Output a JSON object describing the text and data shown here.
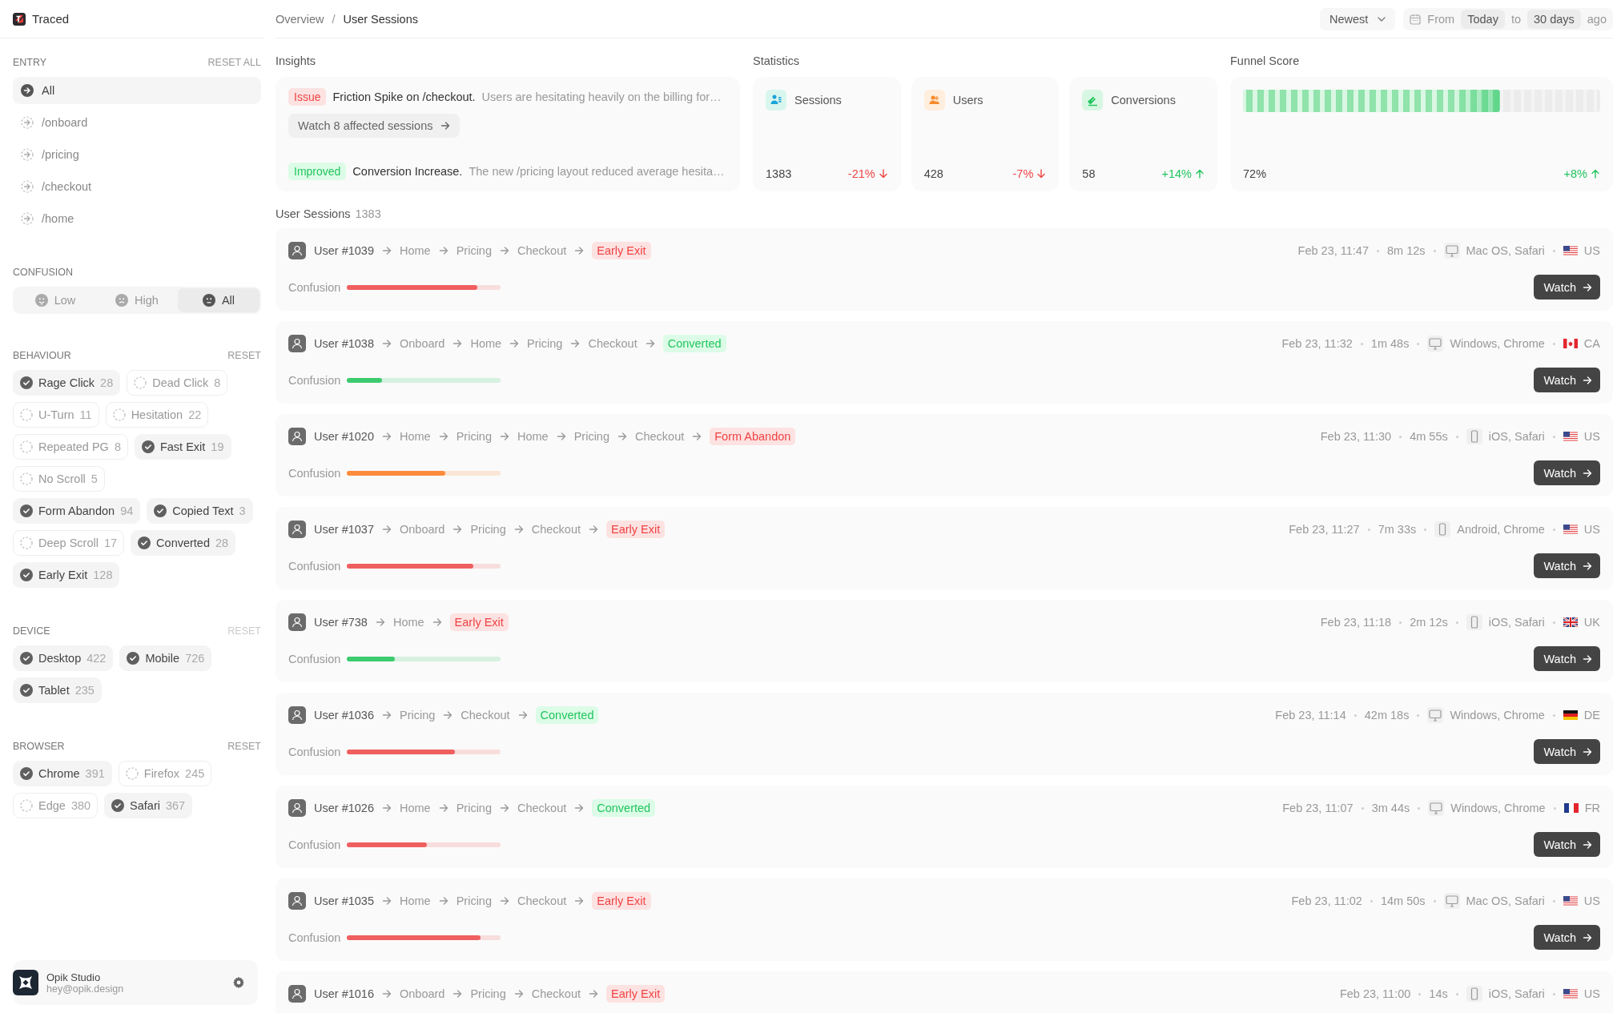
{
  "brand": {
    "name": "Traced"
  },
  "breadcrumb": {
    "separator": "/",
    "items": [
      "Overview",
      "User Sessions"
    ]
  },
  "sort": {
    "label": "Newest"
  },
  "date_range": {
    "from_label": "From",
    "from": "Today",
    "to_label": "to",
    "to": "30 days",
    "suffix": "ago"
  },
  "sidebar": {
    "entry": {
      "title": "ENTRY",
      "reset": "RESET ALL",
      "items": [
        {
          "label": "All",
          "selected": true
        },
        {
          "label": "/onboard",
          "selected": false
        },
        {
          "label": "/pricing",
          "selected": false
        },
        {
          "label": "/checkout",
          "selected": false
        },
        {
          "label": "/home",
          "selected": false
        }
      ]
    },
    "confusion": {
      "title": "CONFUSION",
      "options": [
        {
          "kind": "low",
          "label": "Low",
          "selected": false
        },
        {
          "kind": "high",
          "label": "High",
          "selected": false
        },
        {
          "kind": "all",
          "label": "All",
          "selected": true
        }
      ]
    },
    "filters": [
      {
        "title": "BEHAVIOUR",
        "reset": "RESET",
        "disabled": false,
        "chip_groups": [
          [
            {
              "label": "Rage Click",
              "count": "28",
              "checked": true
            },
            {
              "label": "Dead Click",
              "count": "8",
              "checked": false
            },
            {
              "label": "U-Turn",
              "count": "11",
              "checked": false
            },
            {
              "label": "Hesitation",
              "count": "22",
              "checked": false
            }
          ],
          [
            {
              "label": "Repeated PG",
              "count": "8",
              "checked": false
            },
            {
              "label": "Fast Exit",
              "count": "19",
              "checked": true
            },
            {
              "label": "No Scroll",
              "count": "5",
              "checked": false
            }
          ],
          [
            {
              "label": "Form Abandon",
              "count": "94",
              "checked": true
            },
            {
              "label": "Copied Text",
              "count": "3",
              "checked": true
            },
            {
              "label": "Deep Scroll",
              "count": "17",
              "checked": false
            },
            {
              "label": "Converted",
              "count": "28",
              "checked": true
            },
            {
              "label": "Early Exit",
              "count": "128",
              "checked": true
            }
          ]
        ]
      },
      {
        "title": "DEVICE",
        "reset": "RESET",
        "disabled": true,
        "chip_groups": [
          [
            {
              "label": "Desktop",
              "count": "422",
              "checked": true
            },
            {
              "label": "Mobile",
              "count": "726",
              "checked": true
            },
            {
              "label": "Tablet",
              "count": "235",
              "checked": true
            }
          ]
        ]
      },
      {
        "title": "BROWSER",
        "reset": "RESET",
        "disabled": false,
        "chip_groups": [
          [
            {
              "label": "Chrome",
              "count": "391",
              "checked": true
            },
            {
              "label": "Firefox",
              "count": "245",
              "checked": false
            },
            {
              "label": "Edge",
              "count": "380",
              "checked": false
            },
            {
              "label": "Safari",
              "count": "367",
              "checked": true
            }
          ]
        ]
      }
    ],
    "account": {
      "name": "Opik Studio",
      "email": "hey@opik.design"
    }
  },
  "insights": {
    "title": "Insights",
    "items": [
      {
        "kind": "issue",
        "badge": "Issue",
        "headline": "Friction Spike on /checkout.",
        "detail": "Users are hesitating heavily on the billing for…",
        "action": "Watch 8 affected sessions"
      },
      {
        "kind": "improved",
        "badge": "Improved",
        "headline": "Conversion Increase.",
        "detail": "The new /pricing layout reduced average hesita…"
      }
    ]
  },
  "statistics": {
    "title": "Statistics",
    "cards": [
      {
        "kind": "sessions",
        "label": "Sessions",
        "value": "1383",
        "change": {
          "label": "-21%",
          "kind": "down"
        }
      },
      {
        "kind": "users",
        "label": "Users",
        "value": "428",
        "change": {
          "label": "-7%",
          "kind": "down"
        }
      },
      {
        "kind": "conversions",
        "label": "Conversions",
        "value": "58",
        "change": {
          "label": "+14%",
          "kind": "up"
        }
      }
    ]
  },
  "funnel": {
    "title": "Funnel Score",
    "level": 0.72,
    "value": "72%",
    "change": {
      "label": "+8%",
      "kind": "up"
    }
  },
  "sessions": {
    "title": "User Sessions",
    "count": "1383",
    "rows": [
      {
        "user": "User #1039",
        "path": [
          "Home",
          "Pricing",
          "Checkout"
        ],
        "outcome": {
          "label": "Early Exit",
          "kind": "negative"
        },
        "time": "Feb 23, 11:47",
        "duration": "8m 12s",
        "platform": {
          "kind": "desktop",
          "label": "Mac OS, Safari"
        },
        "country": {
          "kind": "us",
          "label": "US"
        },
        "confusion_label": "Confusion",
        "confusion": {
          "level": 0.85,
          "color": "#ef5f5f"
        },
        "action": "Watch"
      },
      {
        "user": "User #1038",
        "path": [
          "Onboard",
          "Home",
          "Pricing",
          "Checkout"
        ],
        "outcome": {
          "label": "Converted",
          "kind": "positive"
        },
        "time": "Feb 23, 11:32",
        "duration": "1m 48s",
        "platform": {
          "kind": "desktop",
          "label": "Windows, Chrome"
        },
        "country": {
          "kind": "ca",
          "label": "CA"
        },
        "confusion_label": "Confusion",
        "confusion": {
          "level": 0.23,
          "color": "#3ccb6e"
        },
        "action": "Watch"
      },
      {
        "user": "User #1020",
        "path": [
          "Home",
          "Pricing",
          "Home",
          "Pricing",
          "Checkout"
        ],
        "outcome": {
          "label": "Form Abandon",
          "kind": "negative"
        },
        "time": "Feb 23, 11:30",
        "duration": "4m 55s",
        "platform": {
          "kind": "mobile",
          "label": "iOS, Safari"
        },
        "country": {
          "kind": "us",
          "label": "US"
        },
        "confusion_label": "Confusion",
        "confusion": {
          "level": 0.64,
          "color": "#fb8c3c"
        },
        "action": "Watch"
      },
      {
        "user": "User #1037",
        "path": [
          "Onboard",
          "Pricing",
          "Checkout"
        ],
        "outcome": {
          "label": "Early Exit",
          "kind": "negative"
        },
        "time": "Feb 23, 11:27",
        "duration": "7m 33s",
        "platform": {
          "kind": "mobile",
          "label": "Android, Chrome"
        },
        "country": {
          "kind": "us",
          "label": "US"
        },
        "confusion_label": "Confusion",
        "confusion": {
          "level": 0.82,
          "color": "#ef5f5f"
        },
        "action": "Watch"
      },
      {
        "user": "User #738",
        "path": [
          "Home"
        ],
        "outcome": {
          "label": "Early Exit",
          "kind": "negative"
        },
        "time": "Feb 23, 11:18",
        "duration": "2m 12s",
        "platform": {
          "kind": "mobile",
          "label": "iOS, Safari"
        },
        "country": {
          "kind": "uk",
          "label": "UK"
        },
        "confusion_label": "Confusion",
        "confusion": {
          "level": 0.31,
          "color": "#3ccb6e"
        },
        "action": "Watch"
      },
      {
        "user": "User #1036",
        "path": [
          "Pricing",
          "Checkout"
        ],
        "outcome": {
          "label": "Converted",
          "kind": "positive"
        },
        "time": "Feb 23, 11:14",
        "duration": "42m 18s",
        "platform": {
          "kind": "desktop",
          "label": "Windows, Chrome"
        },
        "country": {
          "kind": "de",
          "label": "DE"
        },
        "confusion_label": "Confusion",
        "confusion": {
          "level": 0.7,
          "color": "#ef5f5f"
        },
        "action": "Watch"
      },
      {
        "user": "User #1026",
        "path": [
          "Home",
          "Pricing",
          "Checkout"
        ],
        "outcome": {
          "label": "Converted",
          "kind": "positive"
        },
        "time": "Feb 23, 11:07",
        "duration": "3m 44s",
        "platform": {
          "kind": "desktop",
          "label": "Windows, Chrome"
        },
        "country": {
          "kind": "fr",
          "label": "FR"
        },
        "confusion_label": "Confusion",
        "confusion": {
          "level": 0.52,
          "color": "#ef5f5f"
        },
        "action": "Watch"
      },
      {
        "user": "User #1035",
        "path": [
          "Home",
          "Pricing",
          "Checkout"
        ],
        "outcome": {
          "label": "Early Exit",
          "kind": "negative"
        },
        "time": "Feb 23, 11:02",
        "duration": "14m 50s",
        "platform": {
          "kind": "desktop",
          "label": "Mac OS, Safari"
        },
        "country": {
          "kind": "us",
          "label": "US"
        },
        "confusion_label": "Confusion",
        "confusion": {
          "level": 0.87,
          "color": "#ef5f5f"
        },
        "action": "Watch"
      },
      {
        "user": "User #1016",
        "path": [
          "Onboard",
          "Pricing",
          "Checkout"
        ],
        "outcome": {
          "label": "Early Exit",
          "kind": "negative"
        },
        "time": "Feb 23, 11:00",
        "duration": "14s",
        "platform": {
          "kind": "mobile",
          "label": "iOS, Safari"
        },
        "country": {
          "kind": "us",
          "label": "US"
        }
      }
    ]
  }
}
